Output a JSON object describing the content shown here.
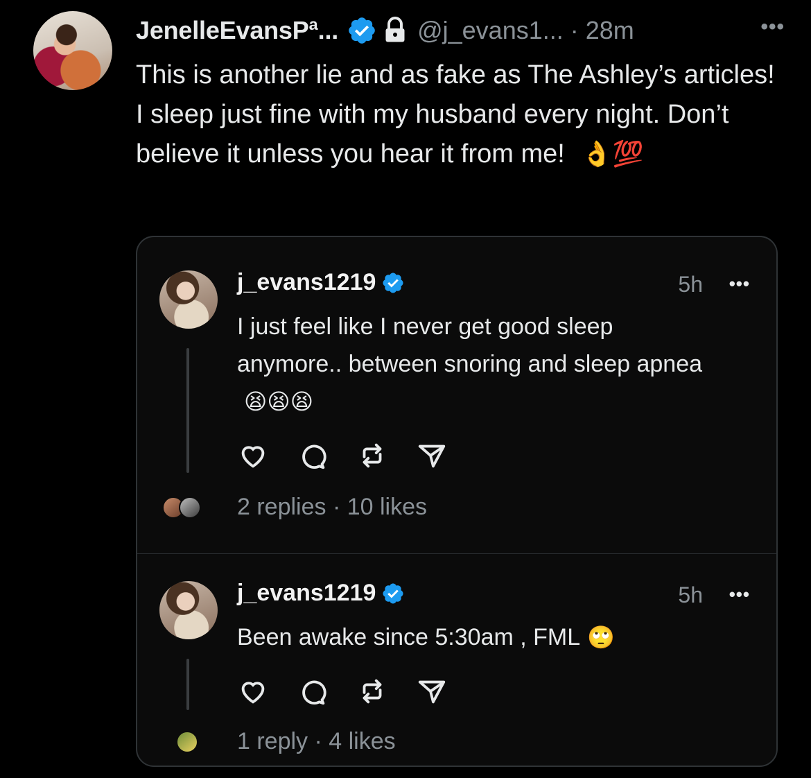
{
  "tweet": {
    "display_name": "JenelleEvansPª...",
    "handle_time": "@j_evans1... · 28m",
    "more": "•••",
    "text": "This is another lie and as fake as The Ashley’s articles! I sleep just fine with my husband every night. Don’t believe it unless you hear it from me!",
    "emojis": "👌💯",
    "icons": [
      "verified-badge-icon",
      "lock-icon"
    ]
  },
  "quote": {
    "posts": [
      {
        "username": "j_evans1219",
        "time": "5h",
        "more": "•••",
        "text": "I just feel like I never get good sleep anymore.. between snoring and sleep apnea",
        "emojis": "😫😫😫",
        "stats": "2 replies · 10 likes"
      },
      {
        "username": "j_evans1219",
        "time": "5h",
        "more": "•••",
        "text": "Been awake since 5:30am , FML",
        "emojis": "🙄",
        "stats": "1 reply · 4 likes"
      }
    ],
    "action_icons": [
      "heart-icon",
      "comment-icon",
      "repost-icon",
      "share-icon"
    ]
  },
  "colors": {
    "background": "#000000",
    "text": "#e7e9ea",
    "secondary": "#8b9298",
    "verified": "#1d9bf0"
  }
}
